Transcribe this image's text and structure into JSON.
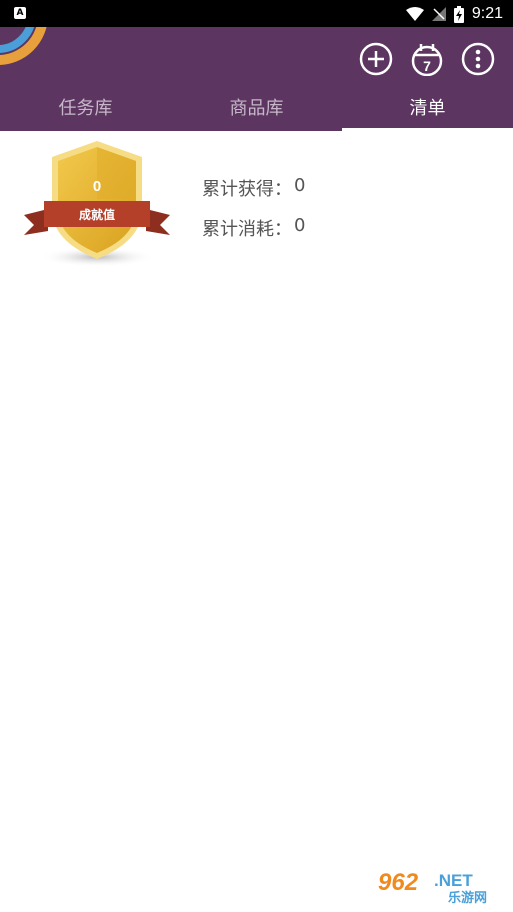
{
  "status_bar": {
    "app_icon_letter": "A",
    "time": "9:21"
  },
  "app_bar": {
    "actions": [
      {
        "name": "add-icon"
      },
      {
        "name": "calendar-icon",
        "text": "7"
      },
      {
        "name": "more-vert-icon"
      }
    ],
    "tabs": [
      {
        "label": "任务库",
        "active": false
      },
      {
        "label": "商品库",
        "active": false
      },
      {
        "label": "清单",
        "active": true
      }
    ]
  },
  "achievement": {
    "value": "0",
    "ribbon_label": "成就值",
    "total_earned_label": "累计获得：",
    "total_earned_value": "0",
    "total_spent_label": "累计消耗：",
    "total_spent_value": "0"
  },
  "watermark": {
    "brand": "962",
    "suffix": ".NET",
    "subtitle": "乐游网"
  },
  "colors": {
    "primary": "#5c3561",
    "shield_gold": "#e9b635",
    "ribbon_red": "#b5402a"
  }
}
